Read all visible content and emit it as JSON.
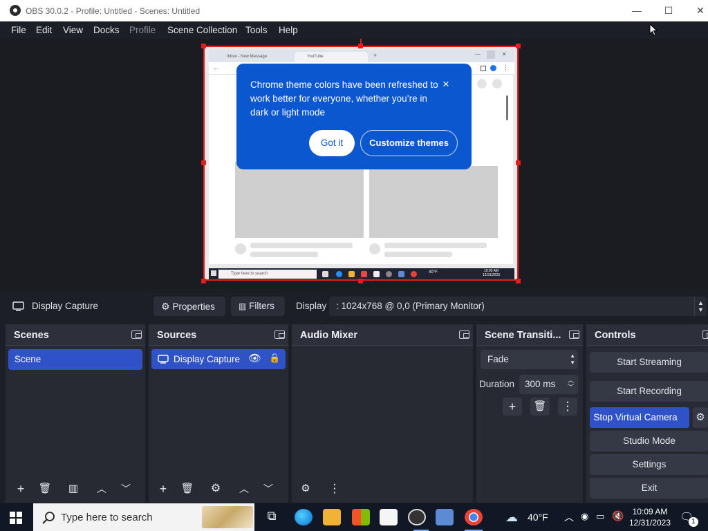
{
  "window": {
    "title": "OBS 30.0.2 - Profile: Untitled - Scenes: Untitled",
    "minimize": "—",
    "maximize": "☐",
    "close": "✕"
  },
  "menu": [
    "File",
    "Edit",
    "View",
    "Docks",
    "Profile",
    "Scene Collection",
    "Tools",
    "Help"
  ],
  "preview": {
    "inner_tabs": [
      "Inbox - New Message",
      "YouTube"
    ],
    "inner_search": "Type here to search",
    "inner_time": "10:09 AM",
    "inner_date": "12/31/2023",
    "inner_temp": "40°F"
  },
  "popup": {
    "message": "Chrome theme colors have been refreshed to work better for everyone, whether you’re in dark or light mode",
    "close_icon": "×",
    "got_it": "Got it",
    "customize": "Customize themes"
  },
  "source_toolbar": {
    "source_name": "Display Capture",
    "properties": "Properties",
    "filters": "Filters",
    "display_label": "Display",
    "display_value": ": 1024x768 @ 0,0 (Primary Monitor)"
  },
  "scenes": {
    "title": "Scenes",
    "items": [
      "Scene"
    ]
  },
  "sources": {
    "title": "Sources",
    "items": [
      "Display Capture"
    ]
  },
  "audio_mixer": {
    "title": "Audio Mixer"
  },
  "transitions": {
    "title": "Scene Transiti...",
    "selected": "Fade",
    "duration_label": "Duration",
    "duration_value": "300 ms"
  },
  "controls": {
    "title": "Controls",
    "start_streaming": "Start Streaming",
    "start_recording": "Start Recording",
    "virtual_camera": "Stop Virtual Camera",
    "studio_mode": "Studio Mode",
    "settings": "Settings",
    "exit": "Exit"
  },
  "taskbar": {
    "search_placeholder": "Type here to search",
    "weather": "40°F",
    "time": "10:09 AM",
    "date": "12/31/2023",
    "notifications": "1"
  },
  "colors": {
    "accent": "#2f52c9",
    "selection_border": "#e21d1d",
    "popup": "#0b57d0"
  }
}
